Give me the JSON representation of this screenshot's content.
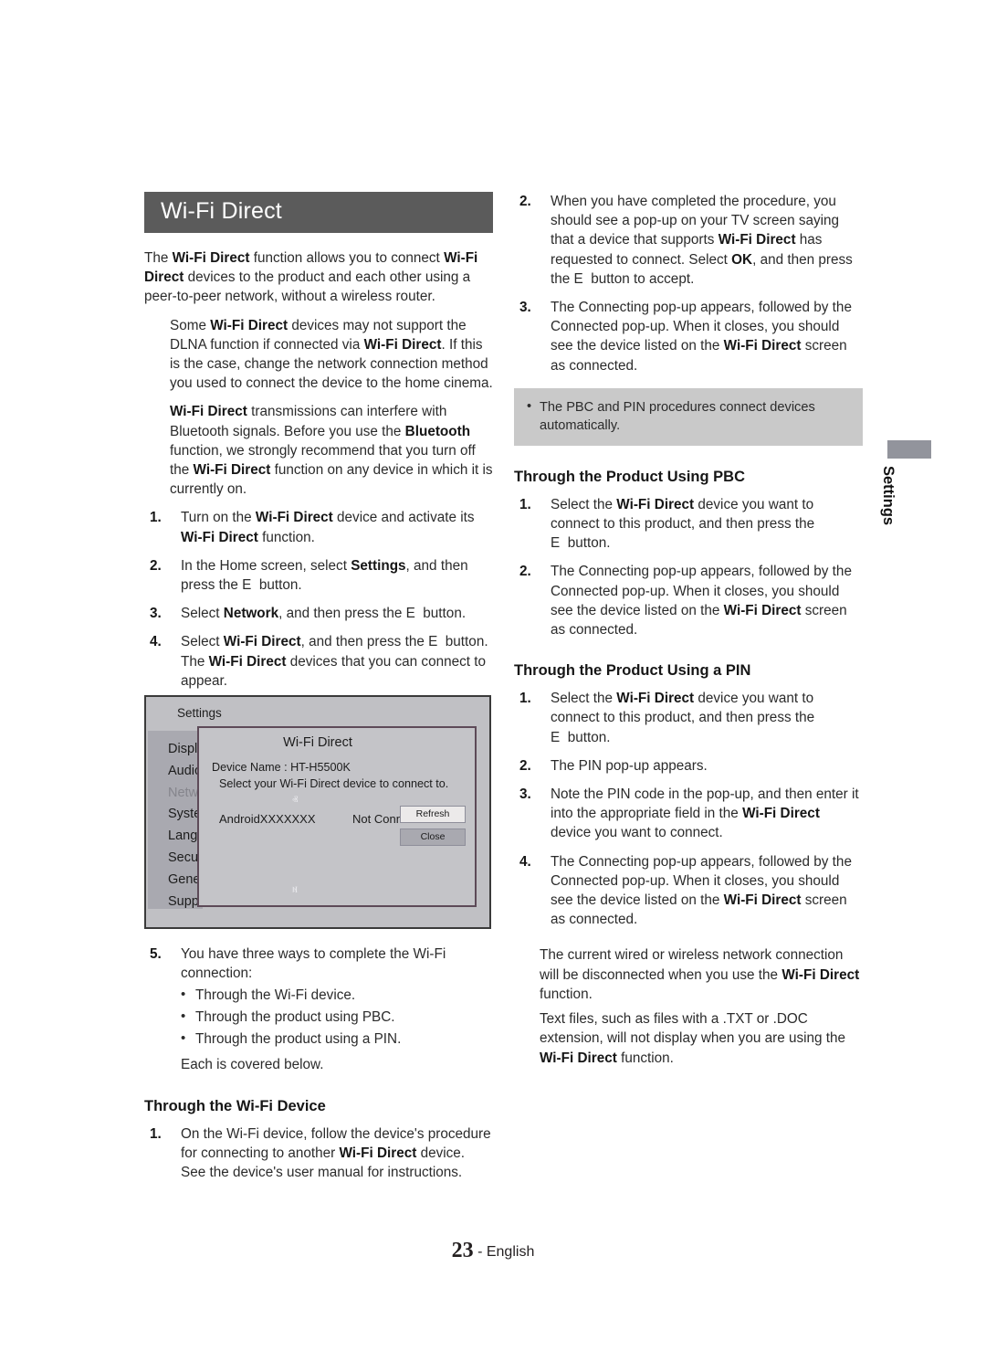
{
  "document": {
    "section_title": "Wi-Fi Direct",
    "footer": {
      "page_number": "23",
      "separator": " - ",
      "language": "English"
    },
    "side_tab": {
      "label": "Settings",
      "color": "#92949c"
    },
    "colors": {
      "section_bar": "#5b5b5b",
      "note_box": "#c9c9c9",
      "figure_bg": "#c0c0c4",
      "figure_border": "#3a3a3a",
      "popup_border": "#5d4a58",
      "text": "#2b2b2b"
    }
  },
  "left_column": {
    "intro": {
      "p1_pre": "The ",
      "p1_b1": "Wi-Fi Direct",
      "p1_mid": " function allows you to connect ",
      "p1_b2": "Wi-Fi Direct",
      "p1_post": " devices to the product and each other using a peer-to-peer network, without a wireless router."
    },
    "note1": {
      "pre": "Some ",
      "b1": "Wi-Fi Direct",
      "mid": " devices may not support the DLNA function if connected via ",
      "b2": "Wi-Fi Direct",
      "post": ". If this is the case, change the network connection method you used to connect the device to the home cinema."
    },
    "note2": {
      "b1": "Wi-Fi Direct",
      "mid1": " transmissions can interfere with Bluetooth signals. Before you use the ",
      "b2": "Bluetooth",
      "mid2": " function, we strongly recommend that you turn off the ",
      "b3": "Wi-Fi Direct",
      "post": " function on any device in which it is currently on."
    },
    "steps": [
      {
        "num": "1.",
        "pre": "Turn on the ",
        "b1": "Wi-Fi Direct",
        "mid": " device and activate its ",
        "b2": "Wi-Fi Direct",
        "post": " function."
      },
      {
        "num": "2.",
        "pre": "In the Home screen, select ",
        "b1": "Settings",
        "mid": ", and then press the ",
        "glyph": "E",
        "post": "button."
      },
      {
        "num": "3.",
        "pre": "Select ",
        "b1": "Network",
        "mid": ", and then press the ",
        "glyph": "E",
        "post": "button."
      },
      {
        "num": "4.",
        "pre": "Select ",
        "b1": "Wi-Fi Direct",
        "mid": ", and then press the ",
        "glyph": "E",
        "post": "button.",
        "extra_pre": "The ",
        "extra_b": "Wi-Fi Direct",
        "extra_post": " devices that you can connect to appear."
      }
    ],
    "step5": {
      "num": "5.",
      "text": "You have three ways to complete the Wi-Fi connection:",
      "bullets": [
        "Through the Wi-Fi device.",
        "Through the product using PBC.",
        "Through the product using a PIN."
      ],
      "closing": "Each is covered below."
    },
    "subheading": "Through the Wi-Fi Device",
    "device_steps": [
      {
        "num": "1.",
        "pre": "On the Wi-Fi device, follow the device's procedure for connecting to another ",
        "b1": "Wi-Fi Direct",
        "post": " device. See the device's user manual for instructions."
      }
    ]
  },
  "figure": {
    "name": "wi-fi-direct-settings-screen",
    "menu_title": "Settings",
    "menu_items": [
      {
        "label": "Display",
        "selected": false
      },
      {
        "label": "Audio",
        "selected": false
      },
      {
        "label": "Network",
        "selected": true
      },
      {
        "label": "System",
        "selected": false
      },
      {
        "label": "Language",
        "selected": false
      },
      {
        "label": "Security",
        "selected": false
      },
      {
        "label": "General",
        "selected": false
      },
      {
        "label": "Support",
        "selected": false
      }
    ],
    "popup": {
      "title": "Wi-Fi Direct",
      "device_name_label": "Device Name : HT-H5500K",
      "hint": "Select your Wi-Fi Direct device to connect to.",
      "scroll_up": "ⱏ",
      "scroll_down": "ⱝ",
      "device_list": [
        {
          "name": "AndroidXXXXXXX",
          "status": "Not Connected"
        }
      ],
      "buttons": [
        {
          "label": "Refresh"
        },
        {
          "label": "Close"
        }
      ]
    }
  },
  "right_column": {
    "continued_steps": [
      {
        "num": "2.",
        "pre": "When you have completed the procedure, you should see a pop-up on your TV screen saying that a device that supports ",
        "b1": "Wi-Fi Direct",
        "mid": " has requested to connect. Select ",
        "b2": "OK",
        "mid2": ", and then press the ",
        "glyph": "E",
        "post": "button to accept."
      },
      {
        "num": "3.",
        "pre": "The Connecting pop-up appears, followed by the Connected pop-up. When it closes, you should see the device listed on the ",
        "b1": "Wi-Fi Direct",
        "post": " screen as connected."
      }
    ],
    "note_box": {
      "text": "The PBC and PIN procedures connect devices automatically."
    },
    "pbc": {
      "heading": "Through the Product Using PBC",
      "steps": [
        {
          "num": "1.",
          "pre": "Select the ",
          "b1": "Wi-Fi Direct",
          "mid": " device you want to connect to this product, and then press the ",
          "glyph": "E",
          "post": "button."
        },
        {
          "num": "2.",
          "pre": "The Connecting pop-up appears, followed by the Connected pop-up. When it closes, you should see the device listed on the ",
          "b1": "Wi-Fi Direct",
          "post": " screen as connected."
        }
      ]
    },
    "pin": {
      "heading": "Through the Product Using a PIN",
      "steps": [
        {
          "num": "1.",
          "pre": "Select the ",
          "b1": "Wi-Fi Direct",
          "mid": " device you want to connect to this product, and then press the ",
          "glyph": "E",
          "post": "button."
        },
        {
          "num": "2.",
          "pre": "The PIN pop-up appears.",
          "b1": "",
          "post": ""
        },
        {
          "num": "3.",
          "pre": "Note the PIN code in the pop-up, and then enter it into the appropriate field in the ",
          "b1": "Wi-Fi Direct",
          "post": " device you want to connect."
        },
        {
          "num": "4.",
          "pre": "The Connecting pop-up appears, followed by the Connected pop-up. When it closes, you should see the device listed on the ",
          "b1": "Wi-Fi Direct",
          "post": " screen as connected."
        }
      ]
    },
    "trailing_notes": [
      {
        "pre": "The current wired or wireless network connection will be disconnected when you use the ",
        "b1": "Wi-Fi Direct",
        "post": " function."
      },
      {
        "pre": "Text files, such as files with a .TXT or .DOC extension, will not display when you are using the ",
        "b1": "Wi-Fi Direct",
        "post": " function."
      }
    ]
  }
}
